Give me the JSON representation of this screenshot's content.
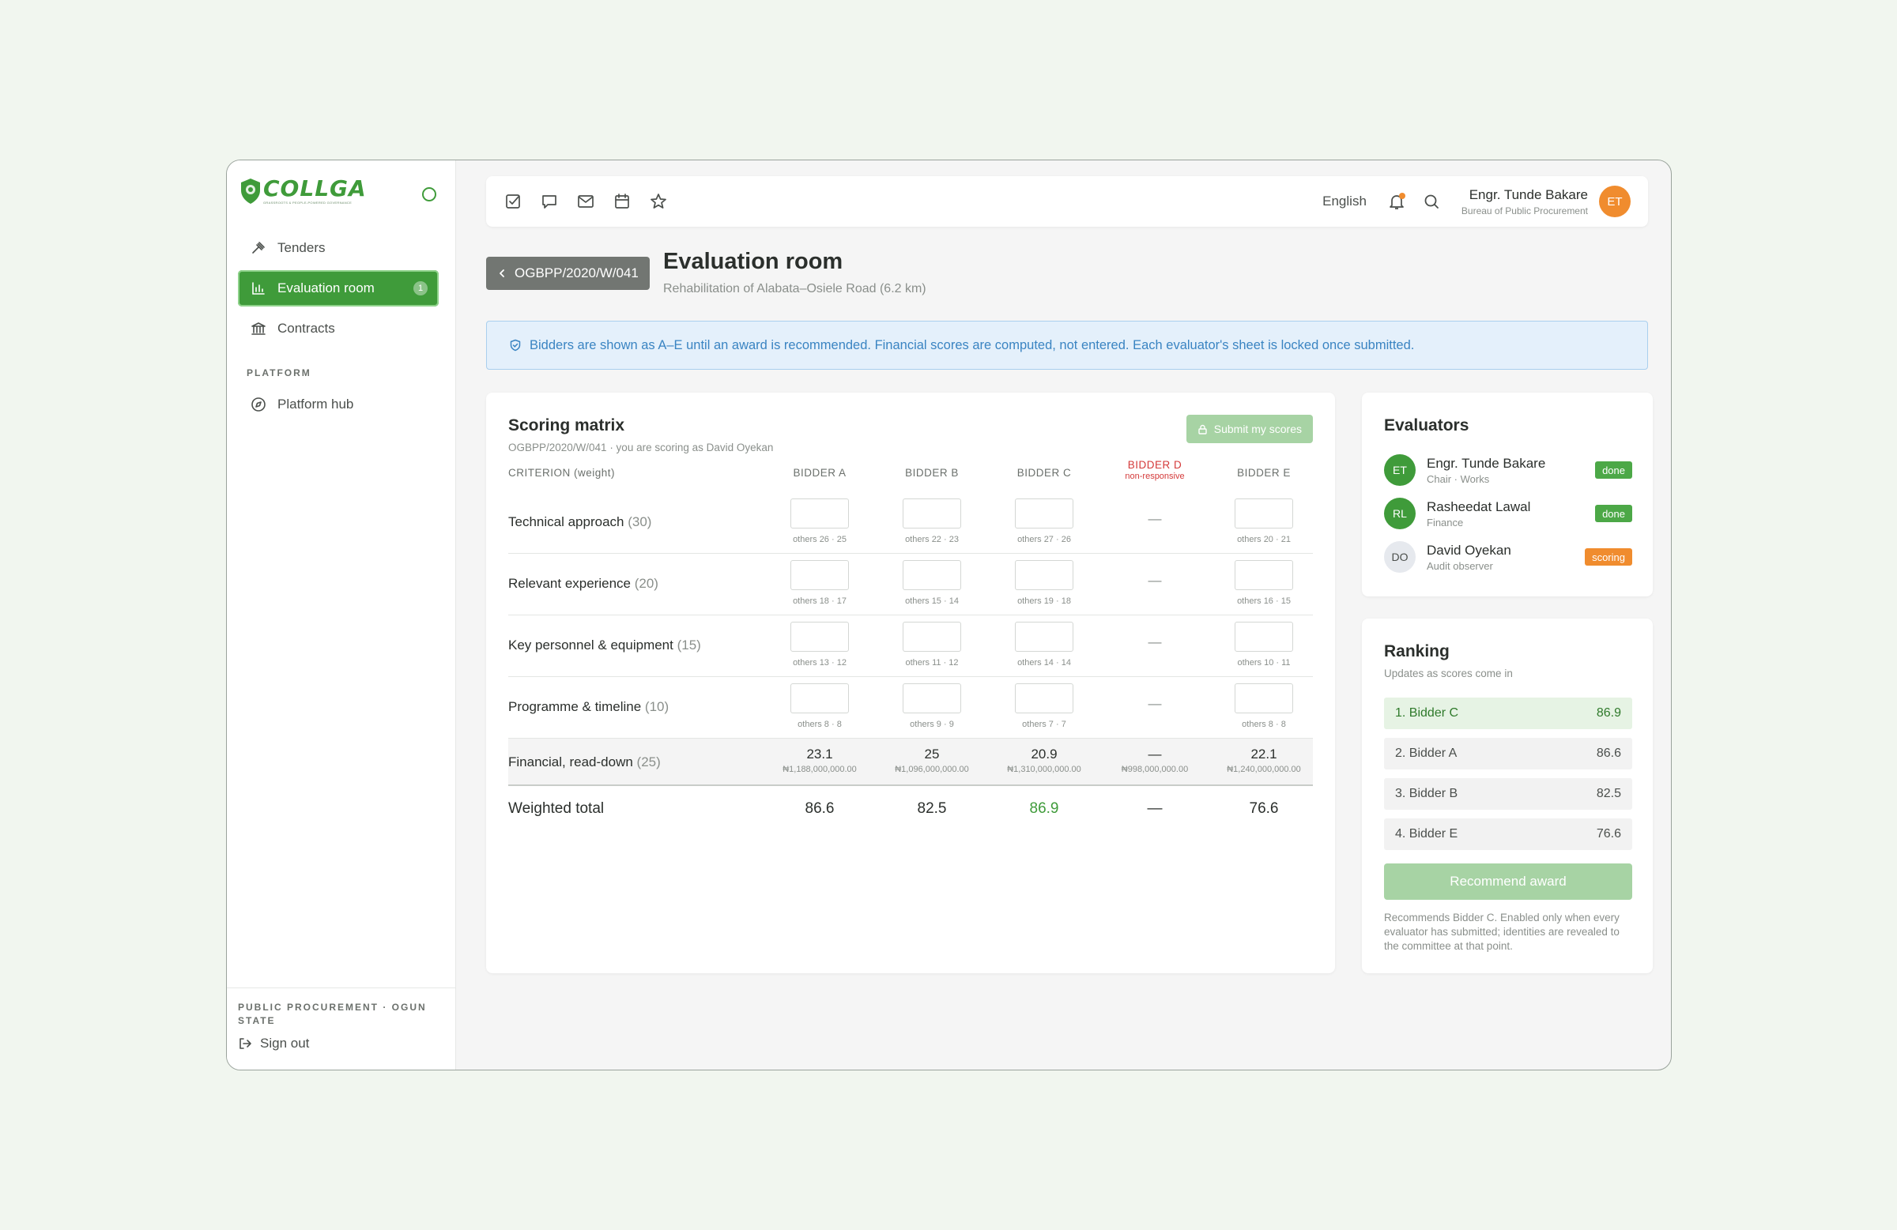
{
  "brand": {
    "name": "COLLGA",
    "tagline": "GRASSROOTS & PEOPLE-POWERED GOVERNANCE"
  },
  "sidebar": {
    "items": [
      {
        "label": "Tenders",
        "icon": "gavel-icon"
      },
      {
        "label": "Evaluation room",
        "icon": "chart-icon",
        "badge": "1",
        "active": true
      },
      {
        "label": "Contracts",
        "icon": "bank-icon"
      }
    ],
    "section_label": "PLATFORM",
    "platform_items": [
      {
        "label": "Platform hub",
        "icon": "compass-icon"
      }
    ],
    "footer_org": "PUBLIC PROCUREMENT · OGUN STATE",
    "signout_label": "Sign out"
  },
  "topbar": {
    "icons": [
      "checkbox-icon",
      "chat-icon",
      "mail-icon",
      "calendar-icon",
      "star-icon"
    ],
    "language": "English",
    "user_name": "Engr. Tunde Bakare",
    "user_org": "Bureau of Public Procurement",
    "user_initials": "ET"
  },
  "header": {
    "back_label": "OGBPP/2020/W/041",
    "title": "Evaluation room",
    "subtitle": "Rehabilitation of Alabata–Osiele Road (6.2 km)"
  },
  "banner": "Bidders are shown as A–E until an award is recommended. Financial scores are computed, not entered. Each evaluator's sheet is locked once submitted.",
  "matrix": {
    "title": "Scoring matrix",
    "subtitle": "OGBPP/2020/W/041 · you are scoring as David Oyekan",
    "submit_label": "Submit my scores",
    "criterion_header": "CRITERION (weight)",
    "bidders": [
      {
        "label": "BIDDER A"
      },
      {
        "label": "BIDDER B"
      },
      {
        "label": "BIDDER C"
      },
      {
        "label": "BIDDER D",
        "note": "non-responsive"
      },
      {
        "label": "BIDDER E"
      }
    ],
    "criteria": [
      {
        "name": "Technical approach",
        "weight": "(30)",
        "others": [
          "others 26 · 25",
          "others 22 · 23",
          "others 27 · 26",
          "—",
          "others 20 · 21"
        ]
      },
      {
        "name": "Relevant experience",
        "weight": "(20)",
        "others": [
          "others 18 · 17",
          "others 15 · 14",
          "others 19 · 18",
          "—",
          "others 16 · 15"
        ]
      },
      {
        "name": "Key personnel & equipment",
        "weight": "(15)",
        "others": [
          "others 13 · 12",
          "others 11 · 12",
          "others 14 · 14",
          "—",
          "others 10 · 11"
        ]
      },
      {
        "name": "Programme & timeline",
        "weight": "(10)",
        "others": [
          "others 8 · 8",
          "others 9 · 9",
          "others 7 · 7",
          "—",
          "others 8 · 8"
        ]
      }
    ],
    "financial": {
      "name": "Financial, read-down",
      "weight": "(25)",
      "scores": [
        "23.1",
        "25",
        "20.9",
        "—",
        "22.1"
      ],
      "amounts": [
        "₦1,188,000,000.00",
        "₦1,096,000,000.00",
        "₦1,310,000,000.00",
        "₦998,000,000.00",
        "₦1,240,000,000.00"
      ]
    },
    "total": {
      "name": "Weighted total",
      "values": [
        "86.6",
        "82.5",
        "86.9",
        "—",
        "76.6"
      ]
    }
  },
  "evaluators": {
    "title": "Evaluators",
    "list": [
      {
        "initials": "ET",
        "name": "Engr. Tunde Bakare",
        "role": "Chair · Works",
        "status": "done"
      },
      {
        "initials": "RL",
        "name": "Rasheedat Lawal",
        "role": "Finance",
        "status": "done"
      },
      {
        "initials": "DO",
        "name": "David Oyekan",
        "role": "Audit observer",
        "status": "scoring"
      }
    ]
  },
  "ranking": {
    "title": "Ranking",
    "subtitle": "Updates as scores come in",
    "rows": [
      {
        "label": "1. Bidder C",
        "score": "86.9"
      },
      {
        "label": "2. Bidder A",
        "score": "86.6"
      },
      {
        "label": "3. Bidder B",
        "score": "82.5"
      },
      {
        "label": "4. Bidder E",
        "score": "76.6"
      }
    ],
    "button_label": "Recommend award",
    "note": "Recommends Bidder C. Enabled only when every evaluator has submitted; identities are revealed to the committee at that point."
  },
  "colors": {
    "brand_green": "#3f9b3a",
    "accent_orange": "#f08c2e",
    "info_blue": "#3a84c2",
    "danger_red": "#d43a3a"
  }
}
